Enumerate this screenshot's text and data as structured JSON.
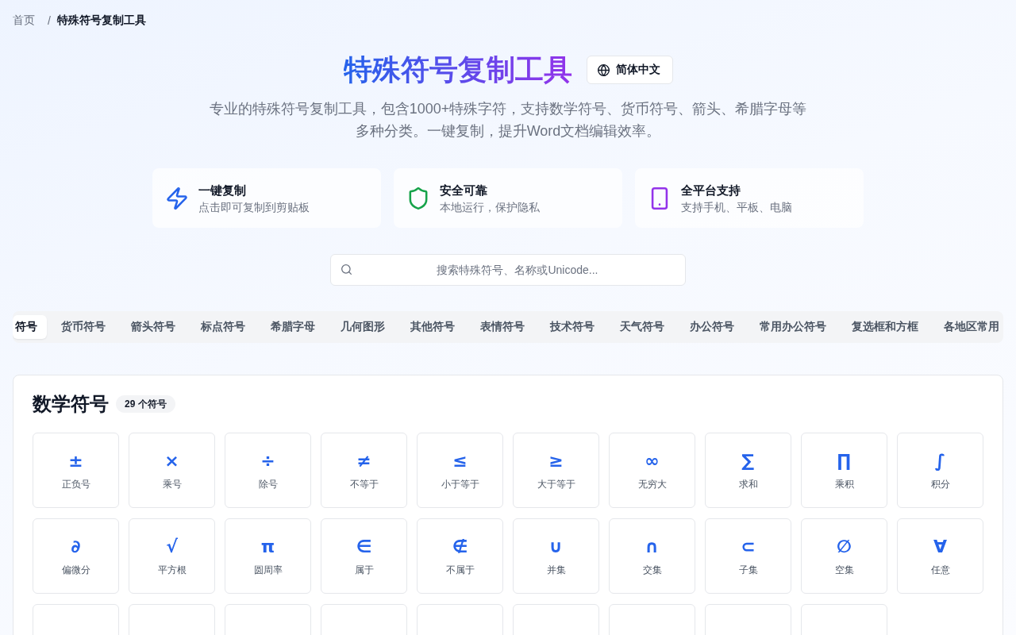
{
  "breadcrumb": {
    "items": [
      {
        "label": "首页",
        "current": false
      },
      {
        "label": "特殊符号复制工具",
        "current": true
      }
    ],
    "separator": "/"
  },
  "header": {
    "title": "特殊符号复制工具",
    "language": "简体中文",
    "description": "专业的特殊符号复制工具，包含1000+特殊字符，支持数学符号、货币符号、箭头、希腊字母等多种分类。一键复制，提升Word文档编辑效率。"
  },
  "features": [
    {
      "kind": "speed",
      "color": "#2563eb",
      "title": "一键复制",
      "subtitle": "点击即可复制到剪贴板"
    },
    {
      "kind": "security",
      "color": "#16a34a",
      "title": "安全可靠",
      "subtitle": "本地运行，保护隐私"
    },
    {
      "kind": "platform",
      "color": "#9333ea",
      "title": "全平台支持",
      "subtitle": "支持手机、平板、电脑"
    }
  ],
  "search": {
    "placeholder": "搜索特殊符号、名称或Unicode..."
  },
  "tabs": [
    {
      "label": "符号",
      "selected": true
    },
    {
      "label": "货币符号",
      "selected": false
    },
    {
      "label": "箭头符号",
      "selected": false
    },
    {
      "label": "标点符号",
      "selected": false
    },
    {
      "label": "希腊字母",
      "selected": false
    },
    {
      "label": "几何图形",
      "selected": false
    },
    {
      "label": "其他符号",
      "selected": false
    },
    {
      "label": "表情符号",
      "selected": false
    },
    {
      "label": "技术符号",
      "selected": false
    },
    {
      "label": "天气符号",
      "selected": false
    },
    {
      "label": "办公符号",
      "selected": false
    },
    {
      "label": "常用办公符号",
      "selected": false
    },
    {
      "label": "复选框和方框",
      "selected": false
    },
    {
      "label": "各地区常用",
      "selected": false
    }
  ],
  "section": {
    "title": "数学符号",
    "count": "29 个符号",
    "symbols": [
      {
        "kind": "symbol",
        "char": "±",
        "name": "正负号"
      },
      {
        "kind": "symbol",
        "char": "×",
        "name": "乘号"
      },
      {
        "kind": "symbol",
        "char": "÷",
        "name": "除号"
      },
      {
        "kind": "symbol",
        "char": "≠",
        "name": "不等于"
      },
      {
        "kind": "symbol",
        "char": "≤",
        "name": "小于等于"
      },
      {
        "kind": "symbol",
        "char": "≥",
        "name": "大于等于"
      },
      {
        "kind": "symbol",
        "char": "∞",
        "name": "无穷大"
      },
      {
        "kind": "symbol",
        "char": "∑",
        "name": "求和"
      },
      {
        "kind": "symbol",
        "char": "∏",
        "name": "乘积"
      },
      {
        "kind": "symbol",
        "char": "∫",
        "name": "积分"
      },
      {
        "kind": "symbol",
        "char": "∂",
        "name": "偏微分"
      },
      {
        "kind": "symbol",
        "char": "√",
        "name": "平方根"
      },
      {
        "kind": "symbol",
        "char": "π",
        "name": "圆周率"
      },
      {
        "kind": "symbol",
        "char": "∈",
        "name": "属于"
      },
      {
        "kind": "symbol",
        "char": "∉",
        "name": "不属于"
      },
      {
        "kind": "symbol",
        "char": "∪",
        "name": "并集"
      },
      {
        "kind": "symbol",
        "char": "∩",
        "name": "交集"
      },
      {
        "kind": "symbol",
        "char": "⊂",
        "name": "子集"
      },
      {
        "kind": "symbol",
        "char": "∅",
        "name": "空集"
      },
      {
        "kind": "symbol",
        "char": "∀",
        "name": "任意"
      },
      {
        "kind": "cut-off"
      },
      {
        "kind": "cut-off"
      },
      {
        "kind": "cut-off"
      },
      {
        "kind": "cut-off"
      },
      {
        "kind": "cut-off"
      },
      {
        "kind": "cut-off"
      },
      {
        "kind": "cut-off"
      },
      {
        "kind": "cut-off"
      },
      {
        "kind": "cut-off"
      }
    ]
  }
}
